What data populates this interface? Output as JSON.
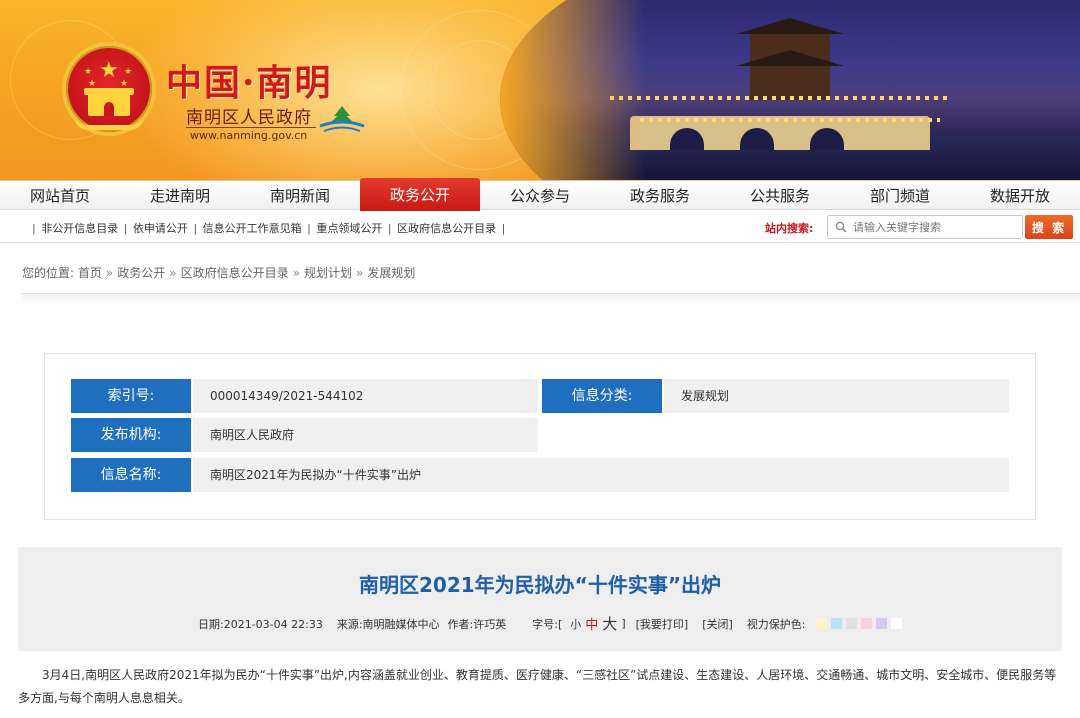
{
  "banner": {
    "title": "中国·南明",
    "subtitle": "南明区人民政府",
    "url": "www.nanming.gov.cn"
  },
  "nav": {
    "items": [
      "网站首页",
      "走进南明",
      "南明新闻",
      "政务公开",
      "公众参与",
      "政务服务",
      "公共服务",
      "部门频道",
      "数据开放"
    ],
    "active_index": 3
  },
  "subbar": {
    "links": [
      "非公开信息目录",
      "依申请公开",
      "信息公开工作意见箱",
      "重点领域公开",
      "区政府信息公开目录"
    ],
    "search_label": "站内搜索:",
    "search_placeholder": "请输入关键字搜索",
    "search_button": "搜 索"
  },
  "breadcrumb": {
    "prefix": "您的位置:",
    "items": [
      "首页",
      "政务公开",
      "区政府信息公开目录",
      "规划计划",
      "发展规划"
    ]
  },
  "info": {
    "index_label": "索引号:",
    "index_value": "000014349/2021-544102",
    "category_label": "信息分类:",
    "category_value": "发展规划",
    "publisher_label": "发布机构:",
    "publisher_value": "南明区人民政府",
    "name_label": "信息名称:",
    "name_value": "南明区2021年为民拟办“十件实事”出炉"
  },
  "article": {
    "title": "南明区2021年为民拟办“十件实事”出炉",
    "date": "日期:2021-03-04 22:33",
    "source": "来源:南明融媒体中心",
    "author": "作者:许巧英",
    "font_label": "字号:[",
    "font_small": "小",
    "font_mid": "中",
    "font_big": "大",
    "font_close": "]",
    "print": "[我要打印]",
    "close": "[关闭]",
    "eye_label": "视力保护色:",
    "eye_colors": [
      "#fbf6c8",
      "#b9e3f5",
      "#e0e0e0",
      "#f6d0dc",
      "#d8c8f0",
      "#ffffff"
    ],
    "body": "3月4日,南明区人民政府2021年拟为民办“十件实事”出炉,内容涵盖就业创业、教育提质、医疗健康、“三感社区”试点建设、生态建设、人居环境、交通畅通、城市文明、安全城市、便民服务等多方面,与每个南明人息息相关。"
  }
}
